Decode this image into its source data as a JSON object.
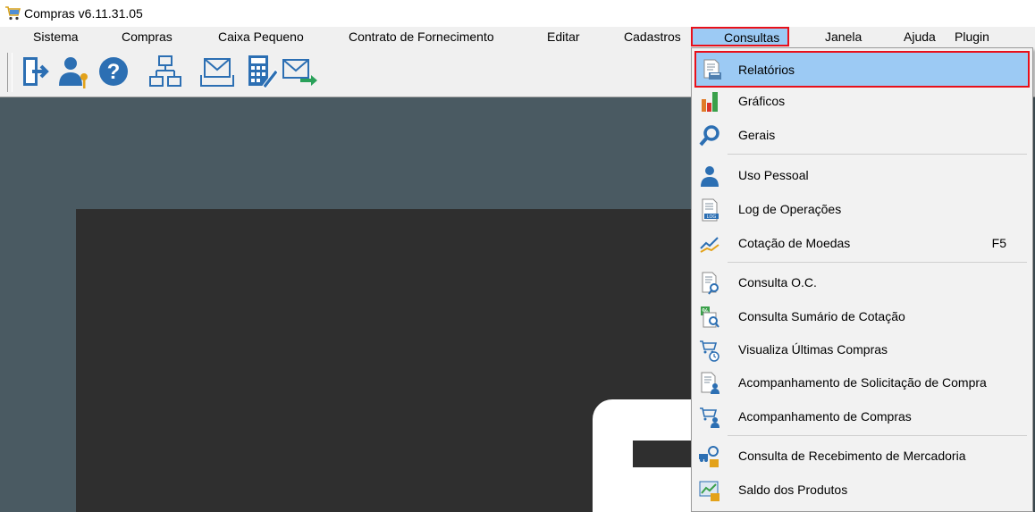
{
  "window": {
    "title": "Compras v6.11.31.05"
  },
  "menubar": {
    "items": [
      {
        "id": "sistema",
        "label": "Sistema"
      },
      {
        "id": "compras",
        "label": "Compras"
      },
      {
        "id": "caixa",
        "label": "Caixa Pequeno"
      },
      {
        "id": "contrato",
        "label": "Contrato de Fornecimento"
      },
      {
        "id": "editar",
        "label": "Editar"
      },
      {
        "id": "cadastros",
        "label": "Cadastros"
      },
      {
        "id": "consultas",
        "label": "Consultas"
      },
      {
        "id": "janela",
        "label": "Janela"
      },
      {
        "id": "ajuda",
        "label": "Ajuda"
      },
      {
        "id": "plugin",
        "label": "Plugin"
      }
    ],
    "active": "Consultas"
  },
  "toolbar": {
    "buttons": [
      "exit-icon",
      "user-key-icon",
      "help-icon",
      "org-chart-icon",
      "mail-inbox-icon",
      "calculator-pen-icon",
      "mail-send-icon"
    ]
  },
  "consultas_menu": {
    "items": [
      {
        "label": "Relatórios",
        "icon": "report-icon",
        "highlighted": true
      },
      {
        "label": "Gráficos",
        "icon": "bar-chart-icon"
      },
      {
        "label": "Gerais",
        "icon": "magnifier-icon"
      },
      {
        "label": "Uso Pessoal",
        "icon": "person-icon"
      },
      {
        "label": "Log de Operações",
        "icon": "log-document-icon"
      },
      {
        "label": "Cotação de Moedas",
        "icon": "currency-chart-icon",
        "shortcut": "F5"
      },
      {
        "label": "Consulta O.C.",
        "icon": "document-search-icon"
      },
      {
        "label": "Consulta Sumário de Cotação",
        "icon": "percent-search-icon"
      },
      {
        "label": "Visualiza Últimas Compras",
        "icon": "cart-clock-icon"
      },
      {
        "label": "Acompanhamento de Solicitação de Compra",
        "icon": "document-people-icon"
      },
      {
        "label": "Acompanhamento de Compras",
        "icon": "cart-people-icon"
      },
      {
        "label": "Consulta de Recebimento de Mercadoria",
        "icon": "receipt-goods-icon"
      },
      {
        "label": "Saldo dos Produtos",
        "icon": "product-balance-icon"
      }
    ]
  },
  "colors": {
    "highlight": "#9ccaf4",
    "annotation_red": "#e8101a",
    "workspace": "#4a5a62"
  }
}
